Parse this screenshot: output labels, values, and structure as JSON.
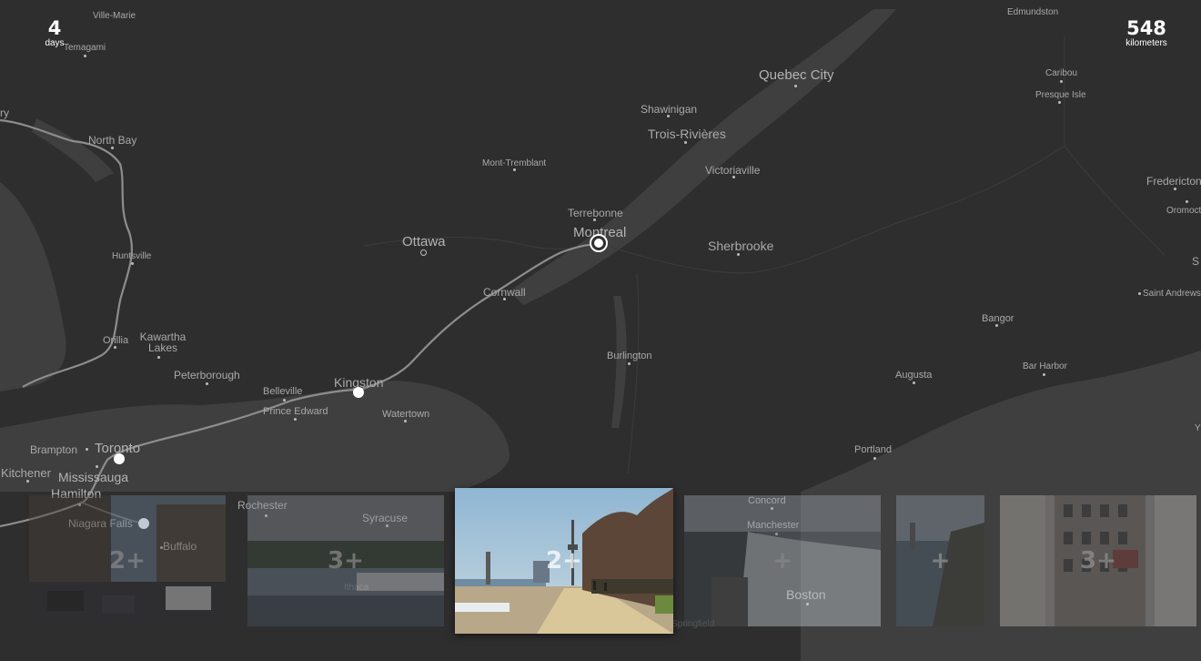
{
  "stats": {
    "days_value": "4",
    "days_unit": "days",
    "distance_value": "548",
    "distance_unit": "kilometers"
  },
  "map": {
    "labels": [
      {
        "id": "ville-marie",
        "text": "Ville-Marie"
      },
      {
        "id": "temagami",
        "text": "Temagami"
      },
      {
        "id": "edmundston",
        "text": "Edmundston"
      },
      {
        "id": "quebec-city",
        "text": "Quebec City"
      },
      {
        "id": "caribou",
        "text": "Caribou"
      },
      {
        "id": "presque-isle",
        "text": "Presque Isle"
      },
      {
        "id": "shawinigan",
        "text": "Shawinigan"
      },
      {
        "id": "trois-rivieres",
        "text": "Trois-Rivières"
      },
      {
        "id": "north-bay",
        "text": "North Bay"
      },
      {
        "id": "mont-tremblant",
        "text": "Mont-Tremblant"
      },
      {
        "id": "victoriaville",
        "text": "Victoriaville"
      },
      {
        "id": "fredericton",
        "text": "Fredericton"
      },
      {
        "id": "oromocto",
        "text": "Oromocto"
      },
      {
        "id": "terrebonne",
        "text": "Terrebonne"
      },
      {
        "id": "montreal",
        "text": "Montreal"
      },
      {
        "id": "ottawa",
        "text": "Ottawa"
      },
      {
        "id": "sherbrooke",
        "text": "Sherbrooke"
      },
      {
        "id": "huntsville",
        "text": "Huntsville"
      },
      {
        "id": "cornwall",
        "text": "Cornwall"
      },
      {
        "id": "saint-andrews",
        "text": "Saint Andrews"
      },
      {
        "id": "bangor",
        "text": "Bangor"
      },
      {
        "id": "orillia",
        "text": "Orillia"
      },
      {
        "id": "kawartha-lakes",
        "text": "Kawartha Lakes"
      },
      {
        "id": "burlington",
        "text": "Burlington"
      },
      {
        "id": "bar-harbor",
        "text": "Bar Harbor"
      },
      {
        "id": "peterborough",
        "text": "Peterborough"
      },
      {
        "id": "augusta",
        "text": "Augusta"
      },
      {
        "id": "kingston",
        "text": "Kingston"
      },
      {
        "id": "belleville",
        "text": "Belleville"
      },
      {
        "id": "prince-edward",
        "text": "Prince Edward"
      },
      {
        "id": "watertown",
        "text": "Watertown"
      },
      {
        "id": "brampton",
        "text": "Brampton"
      },
      {
        "id": "toronto",
        "text": "Toronto"
      },
      {
        "id": "portland",
        "text": "Portland"
      },
      {
        "id": "kitchener",
        "text": "Kitchener"
      },
      {
        "id": "mississauga",
        "text": "Mississauga"
      },
      {
        "id": "hamilton",
        "text": "Hamilton"
      },
      {
        "id": "rochester",
        "text": "Rochester"
      },
      {
        "id": "syracuse",
        "text": "Syracuse"
      },
      {
        "id": "concord",
        "text": "Concord"
      },
      {
        "id": "manchester",
        "text": "Manchester"
      },
      {
        "id": "niagara-falls",
        "text": "Niagara Falls"
      },
      {
        "id": "buffalo",
        "text": "Buffalo"
      },
      {
        "id": "boston",
        "text": "Boston"
      },
      {
        "id": "ithaca",
        "text": "Ithaca"
      },
      {
        "id": "springfield",
        "text": "Springfield"
      },
      {
        "id": "edge-ry",
        "text": "ry"
      },
      {
        "id": "edge-s",
        "text": "S"
      },
      {
        "id": "edge-y",
        "text": "Y"
      }
    ]
  },
  "photos": [
    {
      "id": "photo-1",
      "count": "2+",
      "scene": "street"
    },
    {
      "id": "photo-2",
      "count": "3+",
      "scene": "lake"
    },
    {
      "id": "photo-3",
      "count": "2+",
      "scene": "boardwalk",
      "active": true
    },
    {
      "id": "photo-4",
      "count": "+",
      "scene": "waterfall"
    },
    {
      "id": "photo-5",
      "count": "+",
      "scene": "river"
    },
    {
      "id": "photo-6",
      "count": "3+",
      "scene": "building"
    }
  ]
}
